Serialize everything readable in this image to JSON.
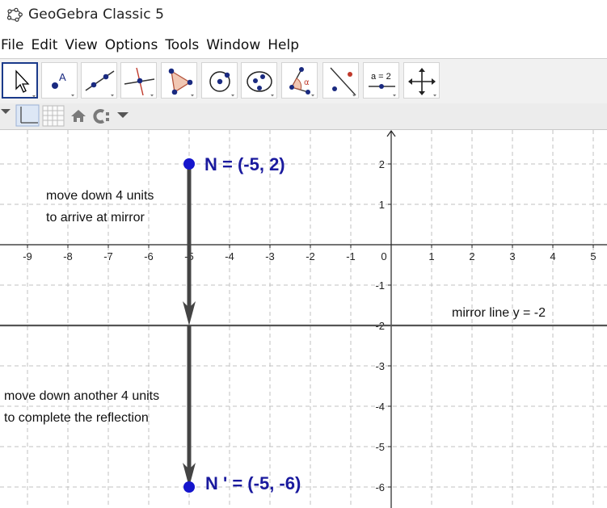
{
  "window": {
    "title": "GeoGebra Classic 5",
    "app_icon": "geogebra-logo-icon"
  },
  "menu": [
    "File",
    "Edit",
    "View",
    "Options",
    "Tools",
    "Window",
    "Help"
  ],
  "toolbar": {
    "tools": [
      {
        "name": "move-tool",
        "icon": "cursor-arrow-icon",
        "selected": true
      },
      {
        "name": "point-tool",
        "icon": "point-icon",
        "text": "A"
      },
      {
        "name": "line-tool",
        "icon": "line-through-points-icon"
      },
      {
        "name": "perpendicular-line-tool",
        "icon": "perpendicular-line-icon"
      },
      {
        "name": "polygon-tool",
        "icon": "polygon-icon"
      },
      {
        "name": "circle-tool",
        "icon": "circle-center-point-icon"
      },
      {
        "name": "conic-tool",
        "icon": "ellipse-icon"
      },
      {
        "name": "angle-tool",
        "icon": "angle-icon",
        "text": "α"
      },
      {
        "name": "reflect-tool",
        "icon": "reflect-about-line-icon"
      },
      {
        "name": "slider-tool",
        "icon": "slider-icon",
        "text": "a = 2"
      },
      {
        "name": "move-graphics-tool",
        "icon": "move-graphics-view-icon"
      }
    ]
  },
  "stylebar": {
    "items": [
      "toggle-stylebar-icon",
      "show-axes-icon",
      "show-grid-icon",
      "standard-view-home-icon",
      "point-capturing-icon"
    ]
  },
  "graph": {
    "x_ticks": [
      "-9",
      "-8",
      "-7",
      "-6",
      "-5",
      "-4",
      "-3",
      "-2",
      "-1",
      "0",
      "1",
      "2",
      "3",
      "4",
      "5"
    ],
    "y_ticks": [
      "2",
      "1",
      "-1",
      "-2",
      "-3",
      "-4",
      "-5",
      "-6"
    ],
    "point_N_label": "N = (-5, 2)",
    "point_N_prime_label": "N ' = (-5, -6)",
    "point_N": [
      -5,
      2
    ],
    "point_N_prime": [
      -5,
      -6
    ],
    "mirror_y": -2,
    "mirror_label": "mirror line y = -2",
    "note1_line1": "move down 4 units",
    "note1_line2": "to arrive at mirror",
    "note2_line1": "move down another 4 units",
    "note2_line2": "to complete the reflection",
    "colors": {
      "point": "#1515cc",
      "label": "#1a1a9e",
      "arrow": "#444444",
      "grid": "#c0c0c0",
      "axis": "#222222",
      "mirror": "#555555"
    }
  }
}
